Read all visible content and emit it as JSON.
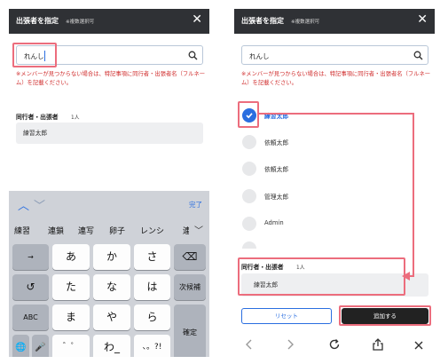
{
  "header": {
    "title": "出張者を指定",
    "subtitle": "※複数選択可"
  },
  "search": {
    "value": "れんし"
  },
  "note": "※メンバーが見つからない場合は、特記事項に同行者・出張者名（フルネーム）を記載ください。",
  "companion": {
    "title": "同行者・出張者",
    "count": "1人",
    "names": [
      "練習太郎"
    ]
  },
  "keyboard": {
    "done": "完了",
    "candidates": [
      "練習",
      "連鎖",
      "連写",
      "卵子",
      "レンシ",
      "連"
    ],
    "rows": [
      [
        "→",
        "あ",
        "か",
        "さ",
        "⌫"
      ],
      [
        "↺",
        "た",
        "な",
        "は",
        "次候補"
      ],
      [
        "ABC",
        "ま",
        "や",
        "ら",
        "確定"
      ],
      [
        "🌐",
        "🎤",
        "゛゜",
        "わ_",
        "、。?!"
      ]
    ]
  },
  "members": [
    {
      "name": "練習太郎",
      "selected": true
    },
    {
      "name": "依頼太郎",
      "selected": false
    },
    {
      "name": "依頼太郎",
      "selected": false
    },
    {
      "name": "管理太郎",
      "selected": false
    },
    {
      "name": "Admin",
      "selected": false
    }
  ],
  "buttons": {
    "reset": "リセット",
    "add": "追加する"
  },
  "colors": {
    "accent": "#2a6ee0",
    "header": "#2f3135",
    "note": "#d02d2d",
    "highlight": "#ec6d7d"
  }
}
